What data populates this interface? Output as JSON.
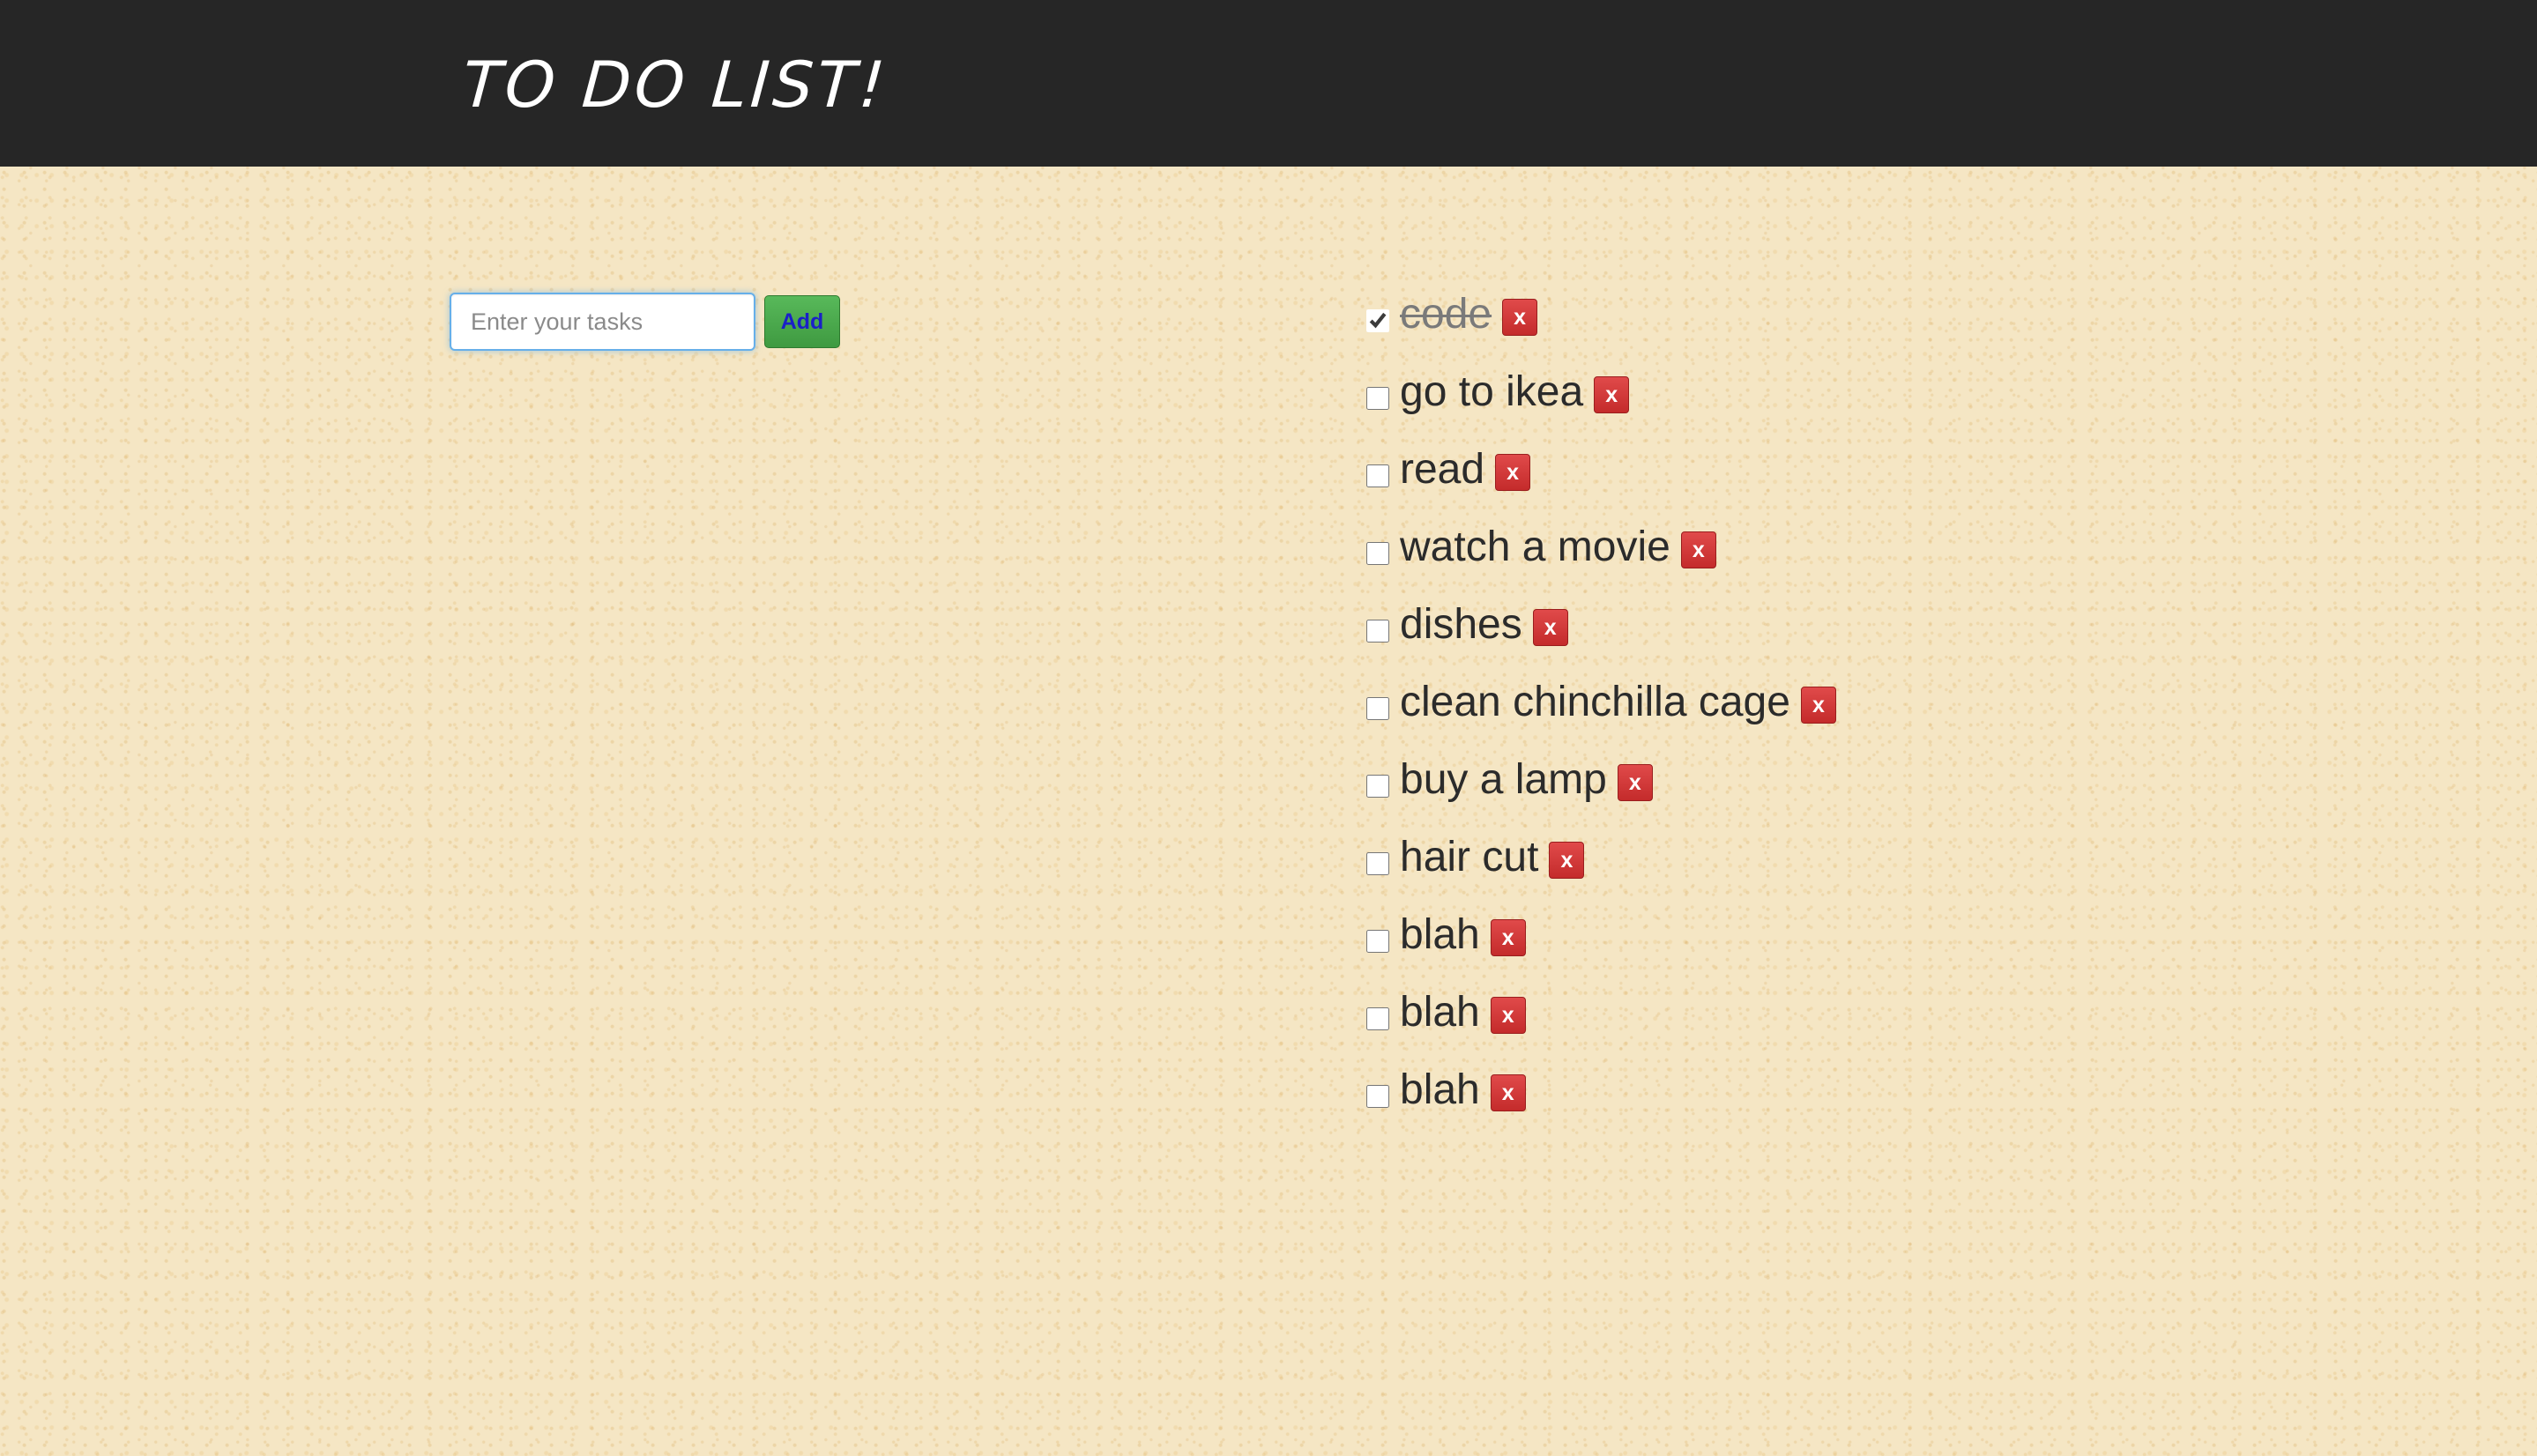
{
  "header": {
    "title": "TO DO LIST!"
  },
  "entry": {
    "placeholder": "Enter your tasks",
    "value": "",
    "add_label": "Add"
  },
  "tasks": [
    {
      "label": "code",
      "checked": true
    },
    {
      "label": "go to ikea",
      "checked": false
    },
    {
      "label": "read",
      "checked": false
    },
    {
      "label": "watch a movie",
      "checked": false
    },
    {
      "label": "dishes",
      "checked": false
    },
    {
      "label": "clean chinchilla cage",
      "checked": false
    },
    {
      "label": "buy a lamp",
      "checked": false
    },
    {
      "label": "hair cut",
      "checked": false
    },
    {
      "label": "blah",
      "checked": false
    },
    {
      "label": "blah",
      "checked": false
    },
    {
      "label": "blah",
      "checked": false
    }
  ],
  "delete_label": "x",
  "colors": {
    "header_bg": "#262626",
    "page_bg": "#f5e6c4",
    "add_button": "#3f9a41",
    "delete_button": "#c42b2b",
    "input_focus": "#66afe9"
  }
}
